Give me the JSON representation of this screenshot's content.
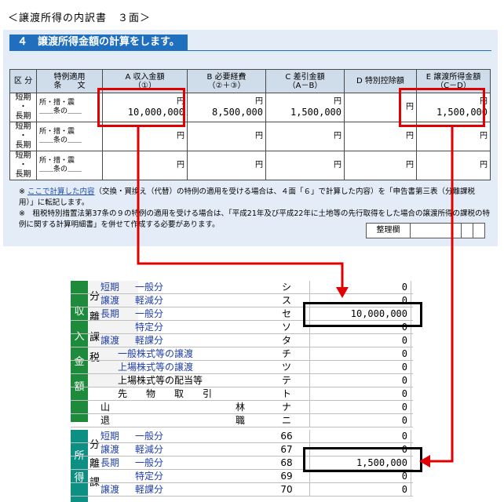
{
  "page_title": "＜譲渡所得の内訳書　３面＞",
  "form": {
    "section_header": "４　譲渡所得金額の計算をします。",
    "columns": [
      {
        "line1": "区 分",
        "line2": ""
      },
      {
        "line1": "特例適用",
        "line2": "条　　文"
      },
      {
        "line1": "A  収入金額",
        "line2": "（①）"
      },
      {
        "line1": "B  必要経費",
        "line2": "（②＋③）"
      },
      {
        "line1": "C  差引金額",
        "line2": "（A－B）"
      },
      {
        "line1": "D  特別控除額",
        "line2": ""
      },
      {
        "line1": "E  譲渡所得金額",
        "line2": "（C－D）"
      }
    ],
    "kubun": [
      "短期",
      "・",
      "長期"
    ],
    "tokurei_label": "所・措・震",
    "jo_label": "条の",
    "yen": "円",
    "rows": [
      {
        "a": "10,000,000",
        "b": "8,500,000",
        "c": "1,500,000",
        "d": "",
        "e": "1,500,000"
      },
      {
        "a": "",
        "b": "",
        "c": "",
        "d": "",
        "e": ""
      },
      {
        "a": "",
        "b": "",
        "c": "",
        "d": "",
        "e": ""
      }
    ],
    "note1_prefix": "※",
    "note1_link": "ここで計算した内容",
    "note1_text": "（交換・買換え（代替）の特例の適用を受ける場合は、４面「６」で計算した内容）を「申告書第三表（分離課税用）」に転記します。",
    "note2": "※　租税特別措置法第37条の９の特例の適用を受ける場合は、「平成21年及び平成22年に土地等の先行取得をした場合の譲渡所得の課税の特例に関する計算明細書」を併せて作成する必要があります。",
    "seiri_label": "整理欄"
  },
  "ledger": {
    "side_income": [
      "収",
      "入",
      "金",
      "額"
    ],
    "side_shotoku": [
      "所",
      "得"
    ],
    "bunri_income": [
      "分",
      "離",
      "課",
      "税"
    ],
    "bunri_shotoku": [
      "分",
      "離",
      "課"
    ],
    "income_rows": [
      {
        "g1": "短期",
        "g2": "一般分",
        "kana": "シ",
        "value": "0"
      },
      {
        "g1": "譲渡",
        "g2": "軽減分",
        "kana": "ス",
        "value": "0"
      },
      {
        "g1": "長期",
        "g2": "一般分",
        "kana": "セ",
        "value": "10,000,000"
      },
      {
        "g1": "",
        "g2": "特定分",
        "kana": "ソ",
        "value": "0"
      },
      {
        "g1": "譲渡",
        "g2": "軽課分",
        "kana": "タ",
        "value": "0"
      },
      {
        "g1": "",
        "g2": "一般株式等の譲渡",
        "kana": "チ",
        "value": "0"
      },
      {
        "g1": "",
        "g2": "上場株式等の譲渡",
        "kana": "ツ",
        "value": "0"
      },
      {
        "g1": "",
        "g2": "上場株式等の配当等",
        "kana": "テ",
        "value": "0"
      },
      {
        "g1": "",
        "g2": "先　　物　　取　　引",
        "kana": "ト",
        "value": "0"
      },
      {
        "g1": "山",
        "g2": "林",
        "kana": "ナ",
        "value": "0"
      },
      {
        "g1": "退",
        "g2": "職",
        "kana": "ニ",
        "value": "0"
      }
    ],
    "shotoku_rows": [
      {
        "g1": "短期",
        "g2": "一般分",
        "kana": "66",
        "value": "0"
      },
      {
        "g1": "譲渡",
        "g2": "軽減分",
        "kana": "67",
        "value": "0"
      },
      {
        "g1": "長期",
        "g2": "一般分",
        "kana": "68",
        "value": "1,500,000"
      },
      {
        "g1": "",
        "g2": "特定分",
        "kana": "69",
        "value": "0"
      },
      {
        "g1": "譲渡",
        "g2": "軽課分",
        "kana": "70",
        "value": "0"
      }
    ]
  },
  "colors": {
    "header_blue": "#1f6fbe",
    "panel_bg": "#e3ecf7",
    "arrow_red": "#e00000",
    "side_green": "#1e8a3c",
    "side_teal": "#0e8f84"
  }
}
